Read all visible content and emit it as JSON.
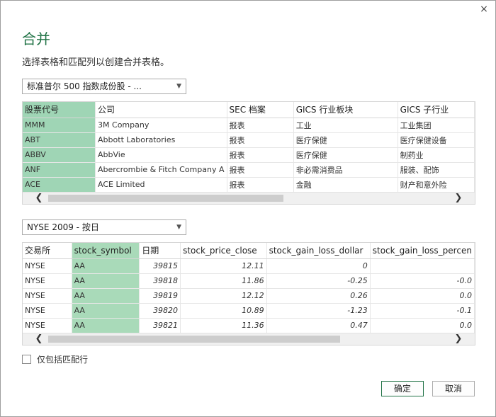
{
  "dialog": {
    "title": "合并",
    "instruction": "选择表格和匹配列以创建合并表格。",
    "close_glyph": "×"
  },
  "table1": {
    "dropdown_value": "标准普尔 500 指数成份股 - ...",
    "headers": [
      "股票代号",
      "公司",
      "SEC 档案",
      "GICS 行业板块",
      "GICS 子行业"
    ],
    "rows": [
      [
        "MMM",
        "3M Company",
        "报表",
        "工业",
        "工业集团"
      ],
      [
        "ABT",
        "Abbott Laboratories",
        "报表",
        "医疗保健",
        "医疗保健设备"
      ],
      [
        "ABBV",
        "AbbVie",
        "报表",
        "医疗保健",
        "制药业"
      ],
      [
        "ANF",
        "Abercrombie & Fitch Company A",
        "报表",
        "非必需消费品",
        "服装、配饰"
      ],
      [
        "ACE",
        "ACE Limited",
        "报表",
        "金融",
        "财产和意外险"
      ]
    ],
    "highlight_color": "#9fd5b5"
  },
  "table2": {
    "dropdown_value": "NYSE 2009 - 按日",
    "headers": [
      "交易所",
      "stock_symbol",
      "日期",
      "stock_price_close",
      "stock_gain_loss_dollar",
      "stock_gain_loss_percen"
    ],
    "rows": [
      [
        "NYSE",
        "AA",
        "39815",
        "12.11",
        "0",
        ""
      ],
      [
        "NYSE",
        "AA",
        "39818",
        "11.86",
        "-0.25",
        "-0.0"
      ],
      [
        "NYSE",
        "AA",
        "39819",
        "12.12",
        "0.26",
        "0.0"
      ],
      [
        "NYSE",
        "AA",
        "39820",
        "10.89",
        "-1.23",
        "-0.1"
      ],
      [
        "NYSE",
        "AA",
        "39821",
        "11.36",
        "0.47",
        "0.0"
      ]
    ],
    "highlight_color": "#a9dab9"
  },
  "options": {
    "only_matching_label": "仅包括匹配行",
    "only_matching_checked": false
  },
  "buttons": {
    "ok": "确定",
    "cancel": "取消"
  },
  "scroll": {
    "left_glyph": "❮",
    "right_glyph": "❯"
  },
  "colors": {
    "accent": "#217346"
  }
}
